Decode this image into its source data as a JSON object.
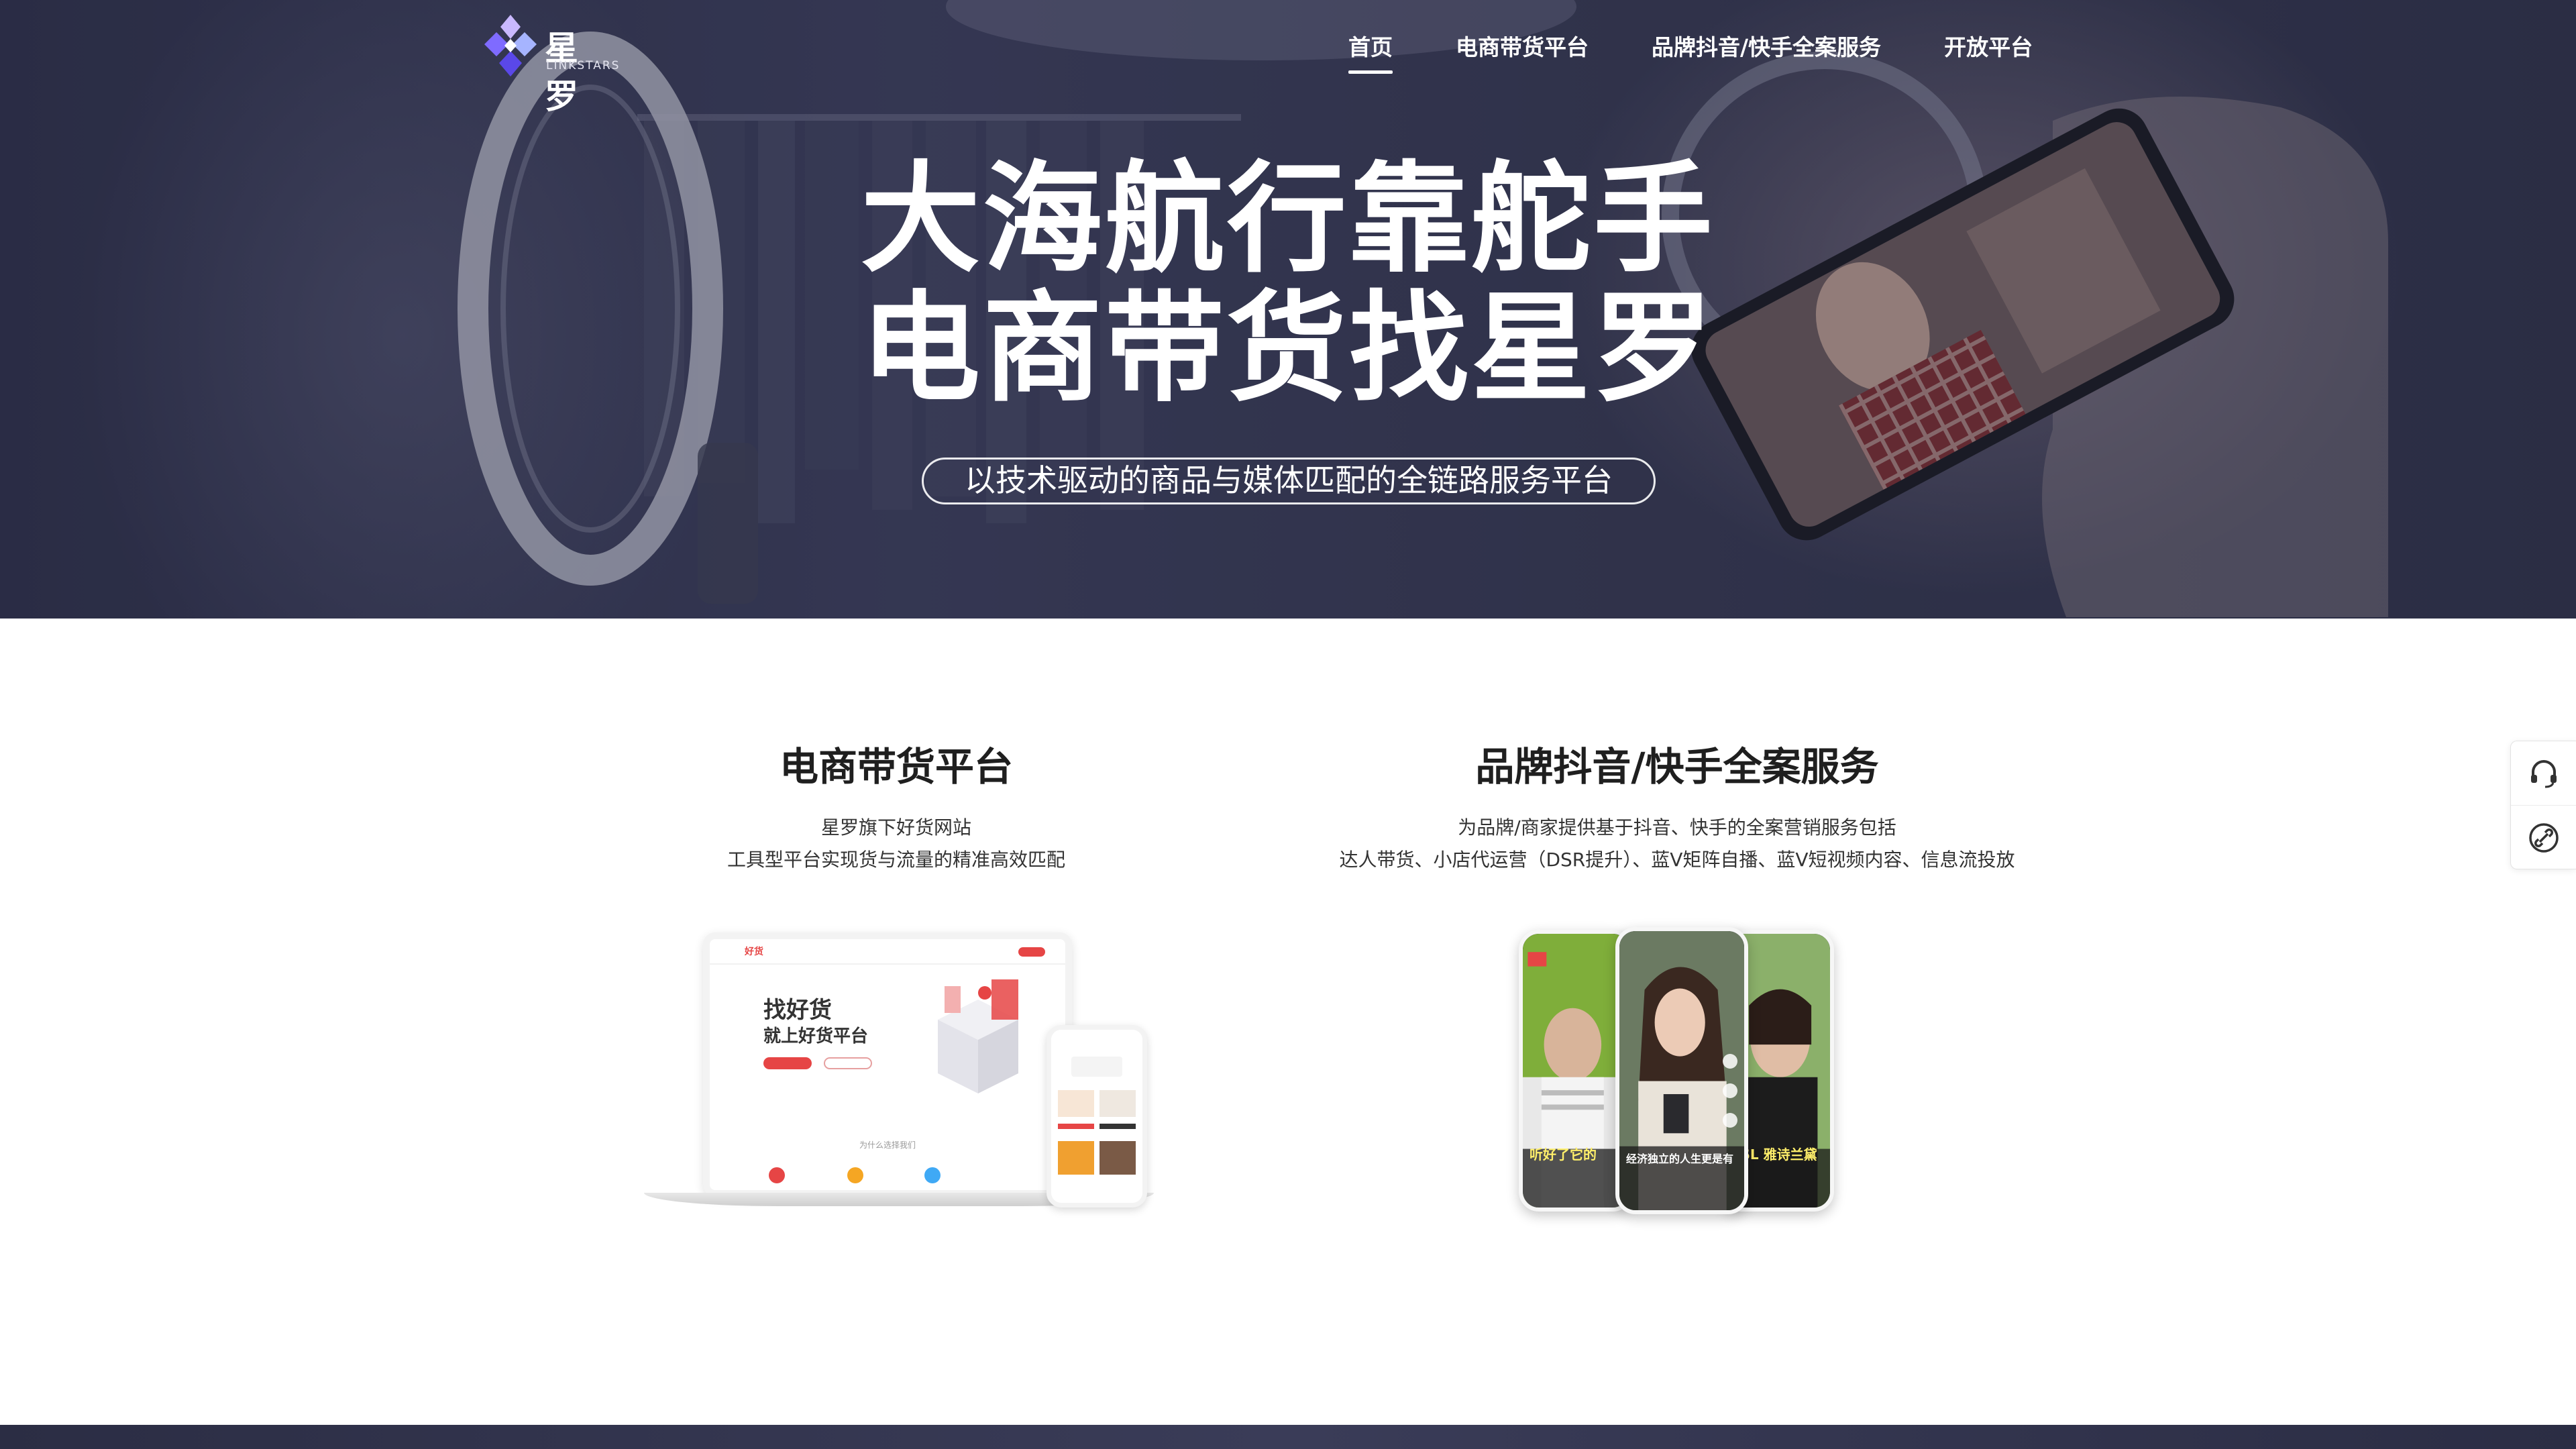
{
  "brand": {
    "name_cn": "星罗",
    "name_en": "LINKSTARS"
  },
  "nav": {
    "items": [
      {
        "label": "首页",
        "active": true
      },
      {
        "label": "电商带货平台",
        "active": false
      },
      {
        "label": "品牌抖音/快手全案服务",
        "active": false
      },
      {
        "label": "开放平台",
        "active": false
      }
    ]
  },
  "hero": {
    "title_line1": "大海航行靠舵手",
    "title_line2": "电商带货找星罗",
    "subtitle": "以技术驱动的商品与媒体匹配的全链路服务平台"
  },
  "services": [
    {
      "title": "电商带货平台",
      "desc_line1": "星罗旗下好货网站",
      "desc_line2": "工具型平台实现货与流量的精准高效匹配",
      "mockup": {
        "brand": "好货",
        "headline1": "找好货",
        "headline2": "就上好货平台",
        "why": "为什么选择我们"
      }
    },
    {
      "title": "品牌抖音/快手全案服务",
      "desc_line1": "为品牌/商家提供基于抖音、快手的全案营销服务包括",
      "desc_line2": "达人带货、小店代运营（DSR提升）、蓝V矩阵自播、蓝V短视频内容、信息流投放",
      "mockup": {
        "caption_left": "听好了它的",
        "caption_mid": "经济独立的人生更是有",
        "caption_right": "YSL 雅诗兰黛"
      }
    }
  ],
  "side_toolbar": {
    "items": [
      "headset-icon",
      "link-icon"
    ]
  },
  "colors": {
    "hero_bg": "#34364f",
    "accent_red": "#e64545",
    "logo_purple": "#6b5cff",
    "text_dark": "#1f1f1f"
  }
}
